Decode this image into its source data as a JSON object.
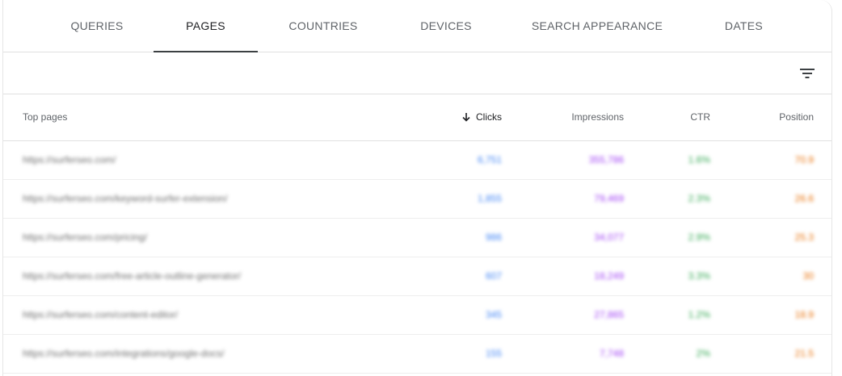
{
  "tabs": [
    {
      "label": "QUERIES",
      "active": false
    },
    {
      "label": "PAGES",
      "active": true
    },
    {
      "label": "COUNTRIES",
      "active": false
    },
    {
      "label": "DEVICES",
      "active": false
    },
    {
      "label": "SEARCH APPEARANCE",
      "active": false
    },
    {
      "label": "DATES",
      "active": false
    }
  ],
  "toolbar": {
    "filter_icon": "filter-list-icon"
  },
  "table": {
    "headers": {
      "page": "Top pages",
      "clicks": "Clicks",
      "impressions": "Impressions",
      "ctr": "CTR",
      "position": "Position"
    },
    "sort": {
      "column": "clicks",
      "direction": "descending",
      "icon": "arrow-down-icon"
    },
    "colors": {
      "clicks": "#4285f4",
      "impressions": "#a142f4",
      "ctr": "#34a853",
      "position": "#e8710a"
    },
    "rows": [
      {
        "page": "https://surferseo.com/",
        "clicks": "6,751",
        "impressions": "355,786",
        "ctr": "1.6%",
        "position": "70.9"
      },
      {
        "page": "https://surferseo.com/keyword-surfer-extension/",
        "clicks": "1,855",
        "impressions": "79,469",
        "ctr": "2.3%",
        "position": "26.6"
      },
      {
        "page": "https://surferseo.com/pricing/",
        "clicks": "986",
        "impressions": "34,077",
        "ctr": "2.9%",
        "position": "25.3"
      },
      {
        "page": "https://surferseo.com/free-article-outline-generator/",
        "clicks": "607",
        "impressions": "18,249",
        "ctr": "3.3%",
        "position": "30"
      },
      {
        "page": "https://surferseo.com/content-editor/",
        "clicks": "345",
        "impressions": "27,865",
        "ctr": "1.2%",
        "position": "18.9"
      },
      {
        "page": "https://surferseo.com/integrations/google-docs/",
        "clicks": "155",
        "impressions": "7,748",
        "ctr": "2%",
        "position": "21.5"
      }
    ]
  }
}
